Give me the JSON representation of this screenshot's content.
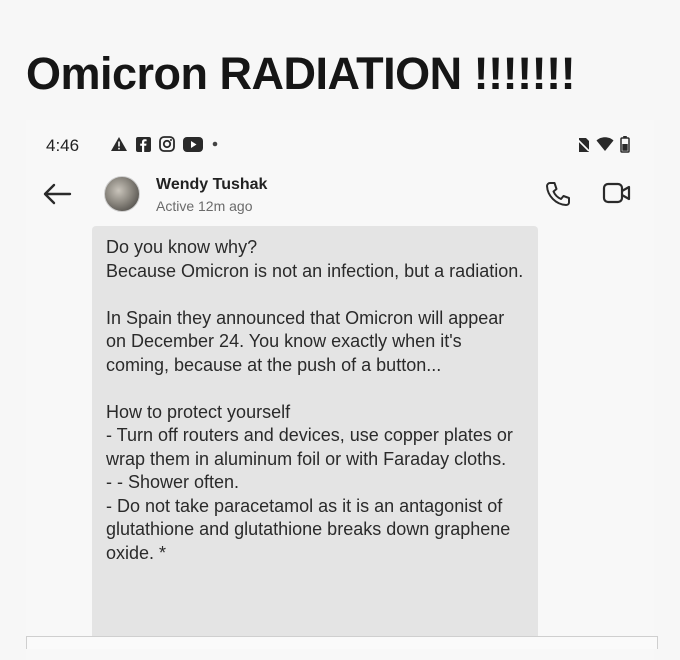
{
  "headline": "Omicron RADIATION !!!!!!!",
  "status_bar": {
    "time": "4:46",
    "left_icons": [
      "warning-icon",
      "facebook-icon",
      "instagram-icon",
      "youtube-icon",
      "dot-icon"
    ],
    "right_icons": [
      "no-sim-icon",
      "wifi-icon",
      "battery-icon"
    ]
  },
  "chat_header": {
    "contact_name": "Wendy Tushak",
    "status": "Active 12m ago",
    "icons": [
      "back-arrow-icon",
      "phone-icon",
      "video-camera-icon"
    ]
  },
  "message": {
    "text": "Do you know why?\nBecause Omicron is not an infection, but a radiation.\n\nIn Spain they announced that Omicron will appear on December 24. You know exactly when it's coming, because at the push of a button...\n\nHow to protect yourself\n- Turn off routers and devices, use copper plates or wrap them in aluminum foil or with Faraday cloths.\n- - Shower often.\n- Do not take paracetamol as it is an antagonist of glutathione and glutathione breaks down graphene oxide. *"
  }
}
